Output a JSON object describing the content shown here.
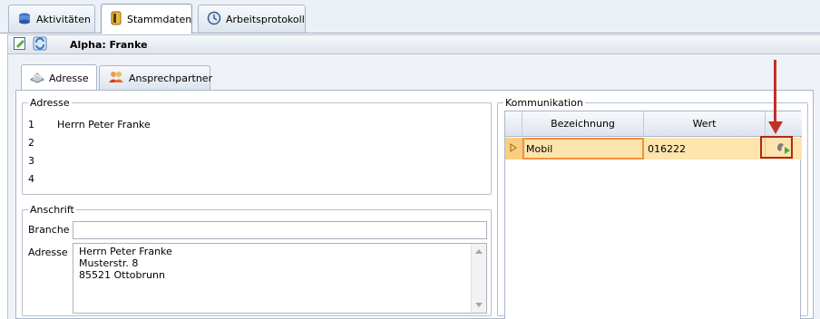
{
  "top_tabs": [
    {
      "label": "Aktivitäten",
      "icon": "activities-icon"
    },
    {
      "label": "Stammdaten",
      "icon": "master-data-icon"
    },
    {
      "label": "Arbeitsprotokoll",
      "icon": "work-log-icon"
    }
  ],
  "toolbar": {
    "title": "Alpha: Franke"
  },
  "sub_tabs": [
    {
      "label": "Adresse",
      "icon": "address-icon"
    },
    {
      "label": "Ansprechpartner",
      "icon": "contact-person-icon"
    }
  ],
  "adresse": {
    "legend": "Adresse",
    "rows": [
      {
        "num": "1",
        "text": "Herrn Peter Franke"
      },
      {
        "num": "2",
        "text": ""
      },
      {
        "num": "3",
        "text": ""
      },
      {
        "num": "4",
        "text": ""
      }
    ]
  },
  "anschrift": {
    "legend": "Anschrift",
    "branche_label": "Branche",
    "branche_value": "",
    "adresse_label": "Adresse",
    "adresse_lines": [
      "Herrn Peter Franke",
      "Musterstr. 8",
      "85521 Ottobrunn"
    ]
  },
  "kommunikation": {
    "legend": "Kommunikation",
    "columns": [
      "Bezeichnung",
      "Wert"
    ],
    "rows": [
      {
        "bezeichnung": "Mobil",
        "wert": "016222"
      }
    ]
  },
  "colors": {
    "accent": "#c0312b",
    "row_highlight": "#fde4ad",
    "focus_border": "#f0913f"
  }
}
